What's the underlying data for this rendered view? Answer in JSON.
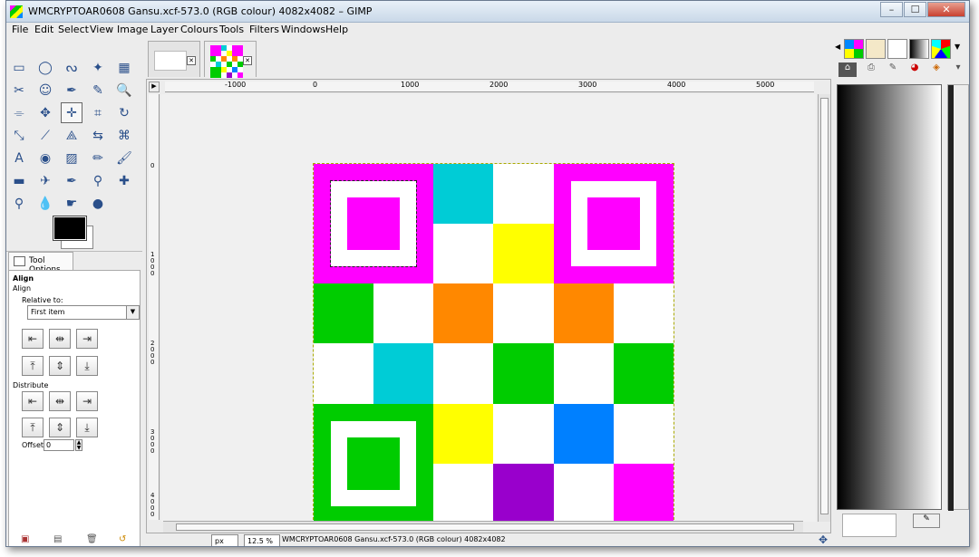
{
  "window": {
    "title": "WMCRYPTOAR0608 Gansu.xcf-573.0 (RGB colour) 4082x4082 – GIMP",
    "min_label": "–",
    "max_label": "☐",
    "close_label": "✕"
  },
  "menubar": {
    "items": [
      "File",
      "Edit",
      "Select",
      "View",
      "Image",
      "Layer",
      "Colours",
      "Tools",
      "Filters",
      "Windows",
      "Help"
    ]
  },
  "toolbox": {
    "tools": [
      "rect-select-icon",
      "ellipse-select-icon",
      "free-select-icon",
      "fuzzy-select-icon",
      "by-colour-select-icon",
      "scissors-select-icon",
      "foreground-select-icon",
      "paths-icon",
      "colour-picker-icon",
      "zoom-icon",
      "measure-icon",
      "move-icon",
      "align-icon",
      "crop-icon",
      "rotate-icon",
      "scale-icon",
      "shear-icon",
      "perspective-icon",
      "flip-icon",
      "cage-transform-icon",
      "text-icon",
      "bucket-fill-icon",
      "blend-icon",
      "pencil-icon",
      "paintbrush-icon",
      "eraser-icon",
      "airbrush-icon",
      "ink-icon",
      "clone-icon",
      "heal-icon",
      "perspective-clone-icon",
      "blur-icon",
      "smudge-icon",
      "dodge-burn-icon"
    ],
    "tool_glyphs": [
      "▭",
      "◯",
      "ᔓ",
      "✦",
      "▦",
      "✂",
      "☺",
      "✒",
      "✎",
      "🔍",
      "⌯",
      "✥",
      "✛",
      "⌗",
      "↻",
      "⤡",
      "⟋",
      "⟁",
      "⇆",
      "⌘",
      "A",
      "◉",
      "▨",
      "✏",
      "🖌",
      "▬",
      "✈",
      "✒",
      "⚲",
      "✚",
      "⚲",
      "💧",
      "☛",
      "●"
    ],
    "active_tool_index": 12
  },
  "tool_options": {
    "tab_label": "Tool Options",
    "heading": "Align",
    "subheading": "Align",
    "relative_to_label": "Relative to:",
    "relative_to_value": "First item",
    "distribute_label": "Distribute",
    "offset_label": "Offset:",
    "offset_value": "0"
  },
  "image_tabs": [
    {
      "name": "empty-image"
    },
    {
      "name": "qr-image"
    }
  ],
  "rulers": {
    "h_labels": [
      "-1000",
      "0",
      "1000",
      "2000",
      "3000",
      "4000",
      "5000"
    ],
    "v_labels": [
      "0",
      "1000",
      "2000",
      "3000",
      "4000"
    ]
  },
  "image": {
    "colors": {
      "magenta": "#ff00ff",
      "cyan": "#00ccd6",
      "yellow": "#ffff00",
      "green": "#00cc00",
      "orange": "#ff8800",
      "blue": "#0080ff",
      "purple": "#9900cc",
      "white": "#ffffff"
    },
    "grid": [
      [
        "magenta",
        "magenta",
        "cyan",
        "white",
        "magenta",
        "magenta"
      ],
      [
        "magenta",
        "magenta",
        "white",
        "yellow",
        "magenta",
        "magenta"
      ],
      [
        "green",
        "white",
        "orange",
        "white",
        "orange",
        "white"
      ],
      [
        "white",
        "cyan",
        "white",
        "green",
        "white",
        "green"
      ],
      [
        "green",
        "green",
        "yellow",
        "white",
        "blue",
        "white"
      ],
      [
        "green",
        "green",
        "white",
        "purple",
        "white",
        "magenta"
      ]
    ]
  },
  "statusbar": {
    "unit": "px",
    "zoom": "12.5 %",
    "info": "WMCRYPTOAR0608 Gansu.xcf-573.0 (RGB colour) 4082x4082"
  },
  "dock": {
    "tabs": [
      "patterns-icon",
      "brushes-tab-icon",
      "tool-presets-icon",
      "gradients-icon",
      "palettes-icon"
    ]
  }
}
